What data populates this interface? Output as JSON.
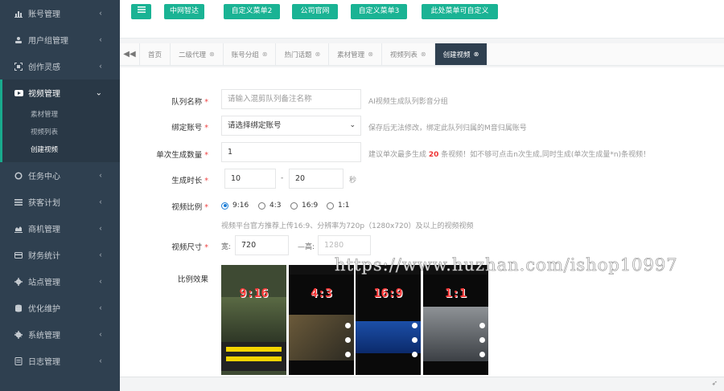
{
  "sidebar": {
    "items": [
      {
        "label": "账号管理",
        "icon": "bar-chart-icon"
      },
      {
        "label": "用户组管理",
        "icon": "users-icon"
      },
      {
        "label": "创作灵感",
        "icon": "expand-icon"
      },
      {
        "label": "视频管理",
        "icon": "video-icon",
        "active": true
      },
      {
        "label": "任务中心",
        "icon": "circle-icon"
      },
      {
        "label": "获客计划",
        "icon": "list-icon"
      },
      {
        "label": "商机管理",
        "icon": "area-chart-icon"
      },
      {
        "label": "财务统计",
        "icon": "card-icon"
      },
      {
        "label": "站点管理",
        "icon": "gear-icon"
      },
      {
        "label": "优化维护",
        "icon": "database-icon"
      },
      {
        "label": "系统管理",
        "icon": "cog-icon"
      },
      {
        "label": "日志管理",
        "icon": "log-icon"
      }
    ],
    "sub_items": [
      "素材管理",
      "视频列表",
      "创建视频"
    ]
  },
  "topbar": {
    "menu_icon": "hamburger-icon",
    "buttons": [
      "中网智达",
      "自定义菜单2",
      "公司官网",
      "自定义菜单3",
      "此处菜单可自定义"
    ]
  },
  "tabs": [
    {
      "label": "首页",
      "closable": false
    },
    {
      "label": "二级代理",
      "closable": true
    },
    {
      "label": "账号分组",
      "closable": true
    },
    {
      "label": "热门话题",
      "closable": true
    },
    {
      "label": "素材管理",
      "closable": true
    },
    {
      "label": "视频列表",
      "closable": true
    },
    {
      "label": "创建视频",
      "closable": true,
      "active": true
    }
  ],
  "form": {
    "queue_name": {
      "label": "队列名称",
      "placeholder": "请输入混剪队列备注名称",
      "hint": "AI视频生成队列影音分组"
    },
    "bind_account": {
      "label": "绑定账号",
      "value": "请选择绑定账号",
      "hint": "保存后无法修改，绑定此队列归属的M音归属账号"
    },
    "batch_count": {
      "label": "单次生成数量",
      "value": "1",
      "hint_pre": "建议单次最多生成",
      "hint_num": "20",
      "hint_post": "条视频！如不够可点击n次生成,同时生成(单次生成量*n)条视频！"
    },
    "duration": {
      "label": "生成时长",
      "min": "10",
      "sep": "-",
      "max": "20",
      "unit": "秒"
    },
    "ratio": {
      "label": "视频比例",
      "options": [
        "9:16",
        "4:3",
        "16:9",
        "1:1"
      ],
      "selected": "9:16",
      "hint": "视频平台官方推荐上传16:9、分辨率为720p（1280x720）及以上的视频视频"
    },
    "size": {
      "label": "视频尺寸",
      "width_label": "宽:",
      "width": "720",
      "height_label": "—高:",
      "height": "1280"
    },
    "preview": {
      "label": "比例效果",
      "items": [
        "9:16",
        "4:3",
        "16:9",
        "1:1"
      ]
    }
  },
  "watermark": "https://www.huzhan.com/ishop10997",
  "colors": {
    "sidebar": "#2f4050",
    "accent": "#1ab394",
    "active_bar": "#19aa8d",
    "warning": "#e33333"
  }
}
